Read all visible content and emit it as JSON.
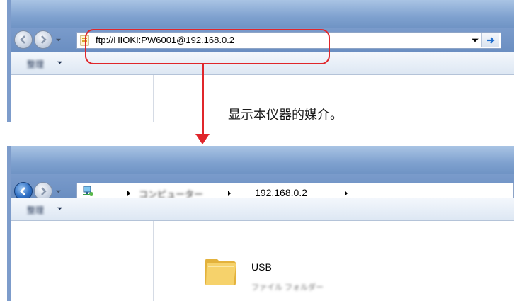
{
  "colors": {
    "callout": "#e0262b",
    "frame": "#7fa1cf",
    "toolbar": "#e6eef8",
    "folder": "#f2c84b",
    "back_active": "#2e6fc4"
  },
  "top_window": {
    "address": "ftp://HIOKI:PW6001@192.168.0.2",
    "toolbar_label": "整理",
    "icons": {
      "back": "back-arrow-icon",
      "forward": "forward-arrow-icon",
      "page": "page-icon",
      "go": "go-arrow-icon"
    }
  },
  "caption": "显示本仪器的媒介。",
  "bottom_window": {
    "breadcrumb_computer": "コンピューター",
    "breadcrumb_ip": "192.168.0.2",
    "toolbar_label": "整理",
    "folder": {
      "name": "USB",
      "type": "ファイル フォルダー",
      "icon": "folder-icon"
    }
  }
}
